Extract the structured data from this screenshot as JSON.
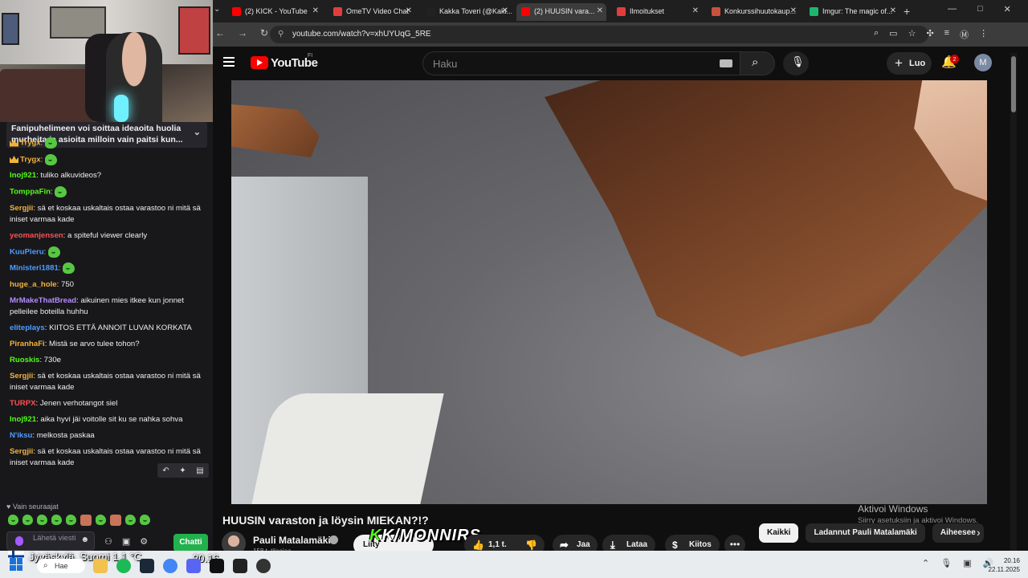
{
  "stream": {
    "pinned_message": "Fanipuhelimeen voi soittaa ideaoita huolia murheita ja asioita milloin vain paitsi kun...",
    "chat": [
      {
        "user": "Trygx",
        "text": "",
        "color": "#f2b33b",
        "crown": true,
        "emote": true
      },
      {
        "user": "Trygx",
        "text": "",
        "color": "#f2b33b",
        "crown": true,
        "emote": true
      },
      {
        "user": "Inoj921",
        "text": " tuliko alkuvideos?",
        "color": "#53fc18"
      },
      {
        "user": "TomppaFin",
        "text": "",
        "color": "#53fc18",
        "emote": true
      },
      {
        "user": "Sergjii",
        "text": " sä et koskaa uskaltais ostaa varastoo ni mitä sä iniset varmaa kade",
        "color": "#f2b33b"
      },
      {
        "user": "yeomanjensen",
        "text": " a spiteful viewer clearly",
        "color": "#ff4f4f"
      },
      {
        "user": "KuuPieru",
        "text": "",
        "color": "#4f9dff",
        "emote": true
      },
      {
        "user": "Ministeri1881",
        "text": "",
        "color": "#4f9dff",
        "emote": true
      },
      {
        "user": "huge_a_hole",
        "text": " 750",
        "color": "#f2b33b"
      },
      {
        "user": "MrMakeThatBread",
        "text": " aikuinen mies itkee kun jonnet pelleilee boteilla huhhu",
        "color": "#b28cff"
      },
      {
        "user": "eliteplays",
        "text": " KIITOS ETTÄ ANNOIT LUVAN KORKATA",
        "color": "#4f9dff"
      },
      {
        "user": "PiranhaFi",
        "text": " Mistä se arvo tulee tohon?",
        "color": "#f2b33b"
      },
      {
        "user": "Ruoskis",
        "text": " 730e",
        "color": "#53fc18"
      },
      {
        "user": "Sergjii",
        "text": " sä et koskaa uskaltais ostaa varastoo ni mitä sä iniset varmaa kade",
        "color": "#f2b33b"
      },
      {
        "user": "TURPX",
        "text": " Jenen verhotangot siel",
        "color": "#ff4f4f"
      },
      {
        "user": "Inoj921",
        "text": " aika hyvi jäi voitolle sit ku se nahka sohva",
        "color": "#53fc18"
      },
      {
        "user": "N'iksu",
        "text": " melkosta paskaa",
        "color": "#4f9dff"
      },
      {
        "user": "Sergjii",
        "text": " sä et koskaa uskaltais ostaa varastoo ni mitä sä iniset varmaa kade",
        "color": "#f2b33b"
      }
    ],
    "followers_label": "Vain seuraajat",
    "input_placeholder": "Lähetä viesti",
    "chat_button": "Chatti"
  },
  "browser": {
    "tabs": [
      {
        "label": "(2) KICK - YouTube",
        "icon": "youtube-icon",
        "color": "#ff0000"
      },
      {
        "label": "OmeTV Video Chat",
        "icon": "ometv-icon",
        "color": "#e23d3d"
      },
      {
        "label": "Kakka Toveri (@Kaki...",
        "icon": "x-icon",
        "color": "#222222"
      },
      {
        "label": "(2) HUUSIN vara...",
        "icon": "youtube-icon",
        "color": "#ff0000",
        "active": true
      },
      {
        "label": "Ilmoitukset",
        "icon": "notification-icon",
        "color": "#e23d3d"
      },
      {
        "label": "Konkurssihuutokaup...",
        "icon": "auction-icon",
        "color": "#c7523c"
      },
      {
        "label": "Imgur: The magic of...",
        "icon": "imgur-icon",
        "color": "#1bb76e"
      }
    ],
    "url": "youtube.com/watch?v=xhUYUqG_5RE"
  },
  "youtube": {
    "logo_text": "YouTube",
    "region": "FI",
    "search_placeholder": "Haku",
    "create_label": "Luo",
    "notification_count": "2",
    "avatar_letter": "M",
    "video_title": "HUUSIN varaston ja löysin MIEKAN?!?",
    "channel_name": "Pauli Matalamäki",
    "subscribers": "158 t. tilaajaa",
    "subscribe_label": "Liity",
    "overlay_text": "K/MONNIRS",
    "likes": "1,1 t.",
    "share_label": "Jaa",
    "download_label": "Lataa",
    "thanks_label": "Kiitos",
    "chips": [
      "Kaikki",
      "Ladannut Pauli Matalamäki",
      "Aiheesee"
    ],
    "windows_watermark": "Aktivoi Windows",
    "windows_watermark_sub": "Siirry asetuksiin ja aktivoi Windows."
  },
  "taskbar": {
    "weather_location": "Jyväskylä, Suomi",
    "temperature": "1,1 °C",
    "stream_time": "20.16",
    "search_label": "Hae",
    "time": "20.16",
    "date": "22.11.2025"
  }
}
